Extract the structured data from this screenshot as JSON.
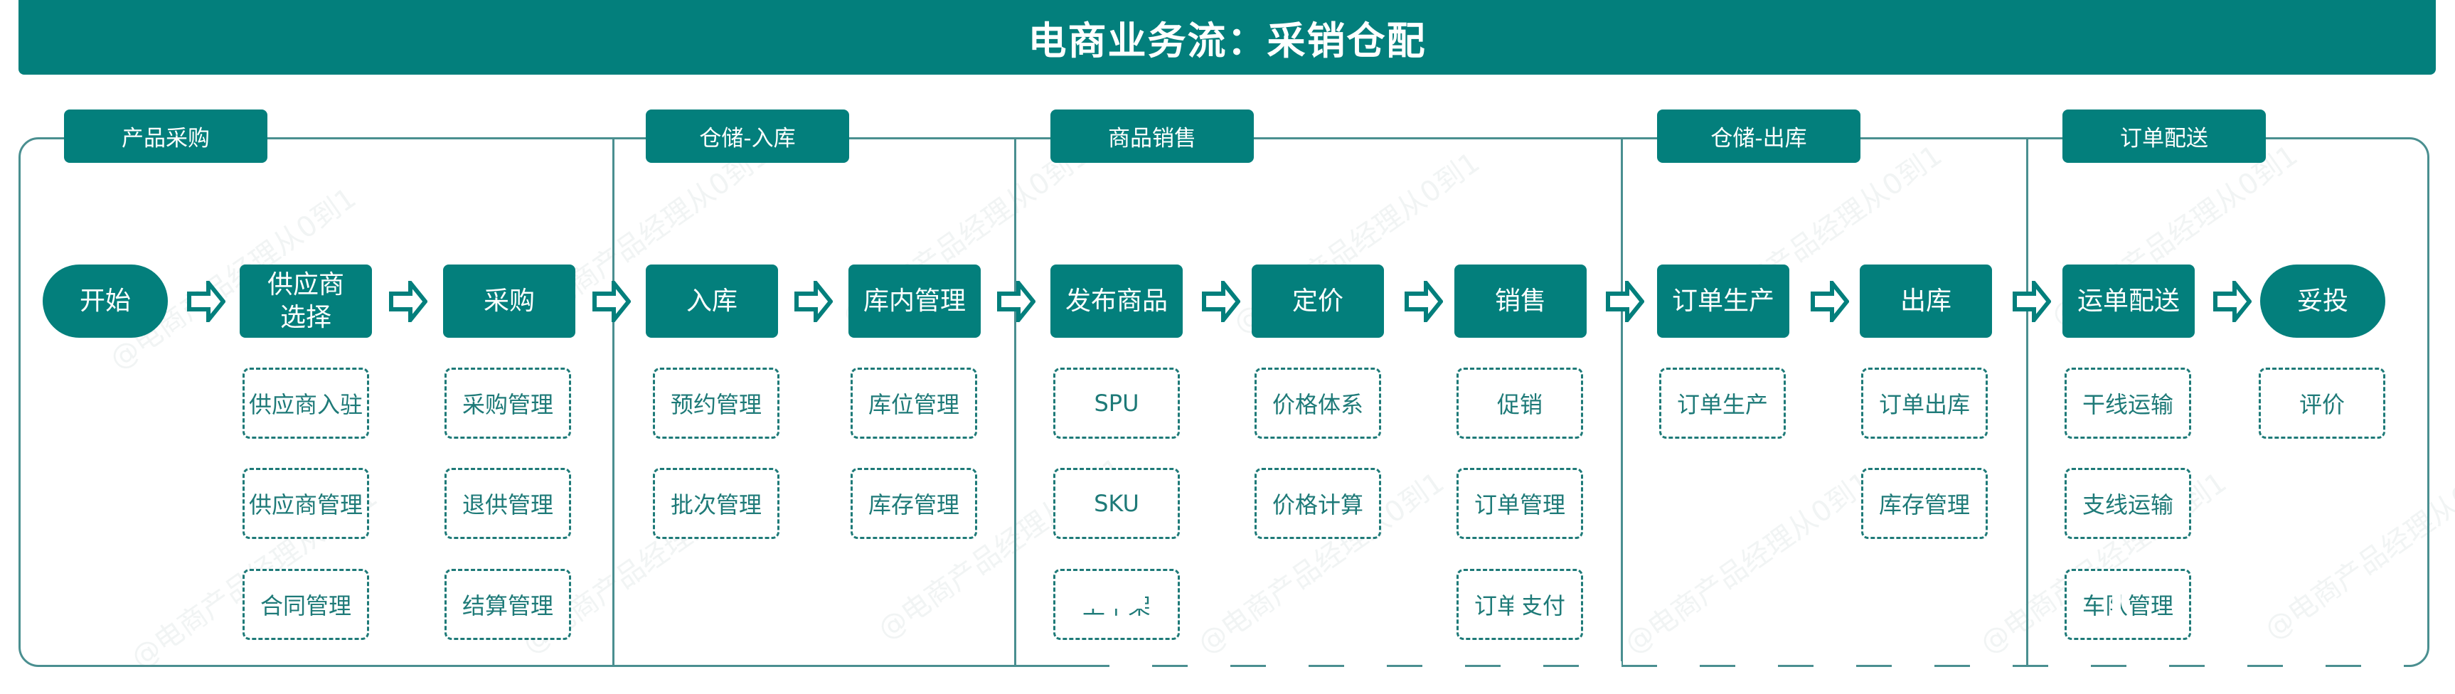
{
  "title": "电商业务流：采销仓配",
  "watermark": "@电商产品经理从0到1",
  "colors": {
    "primary": "#037f7c",
    "border": "#4a8f90",
    "sub_text": "#1e7a78"
  },
  "sections": [
    {
      "label": "产品采购",
      "nodes": [
        {
          "label": "开始",
          "shape": "pill",
          "subs": []
        },
        {
          "label": "供应商\n选择",
          "shape": "rect",
          "subs": [
            "供应商入驻",
            "供应商管理",
            "合同管理"
          ]
        },
        {
          "label": "采购",
          "shape": "rect",
          "subs": [
            "采购管理",
            "退供管理",
            "结算管理"
          ]
        }
      ]
    },
    {
      "label": "仓储-入库",
      "nodes": [
        {
          "label": "入库",
          "shape": "rect",
          "subs": [
            "预约管理",
            "批次管理"
          ]
        },
        {
          "label": "库内管理",
          "shape": "rect",
          "subs": [
            "库位管理",
            "库存管理"
          ]
        }
      ]
    },
    {
      "label": "商品销售",
      "nodes": [
        {
          "label": "发布商品",
          "shape": "rect",
          "subs": [
            "SPU",
            "SKU",
            "上下架"
          ]
        },
        {
          "label": "定价",
          "shape": "rect",
          "subs": [
            "价格体系",
            "价格计算"
          ]
        },
        {
          "label": "销售",
          "shape": "rect",
          "subs": [
            "促销",
            "订单管理",
            "订单支付"
          ]
        }
      ]
    },
    {
      "label": "仓储-出库",
      "nodes": [
        {
          "label": "订单生产",
          "shape": "rect",
          "subs": [
            "订单生产"
          ]
        },
        {
          "label": "出库",
          "shape": "rect",
          "subs": [
            "订单出库",
            "库存管理"
          ]
        }
      ]
    },
    {
      "label": "订单配送",
      "nodes": [
        {
          "label": "运单配送",
          "shape": "rect",
          "subs": [
            "干线运输",
            "支线运输",
            "车队管理"
          ]
        },
        {
          "label": "妥投",
          "shape": "pill",
          "subs": [
            "评价"
          ]
        }
      ]
    }
  ]
}
